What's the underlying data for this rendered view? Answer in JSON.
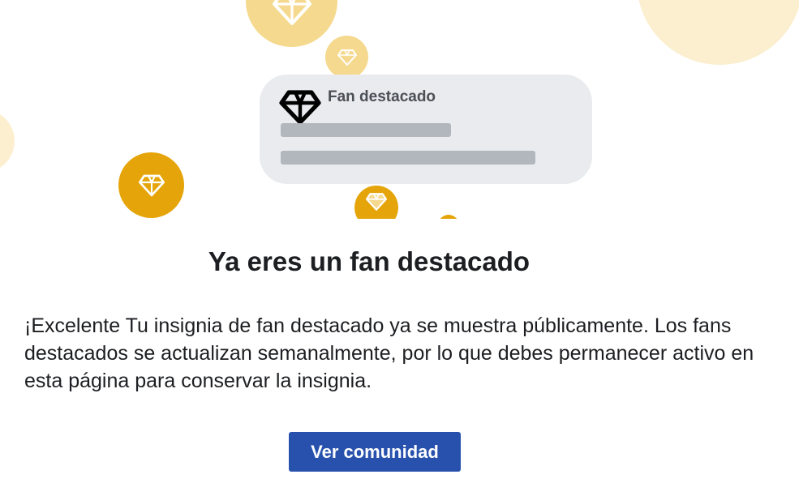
{
  "illustration": {
    "card": {
      "label": "Fan destacado",
      "icon": "diamond-icon"
    },
    "badge_icon": "diamond-icon",
    "colors": {
      "gold": "#e5a50a",
      "gold_light": "#f5d98e",
      "gold_pale": "#fbefcf",
      "card_bg": "#e9ebee",
      "skeleton": "#b2b6bd"
    }
  },
  "dialog": {
    "title": "Ya eres un fan destacado",
    "body": "¡Excelente Tu insignia de fan destacado ya se muestra públicamente. Los fans destacados se actualizan semanalmente, por lo que debes permanecer activo en esta página para conservar la insignia.",
    "button_label": "Ver comunidad"
  },
  "colors": {
    "button_bg": "#2751ac",
    "button_text": "#ffffff",
    "text": "#1c1e21"
  }
}
